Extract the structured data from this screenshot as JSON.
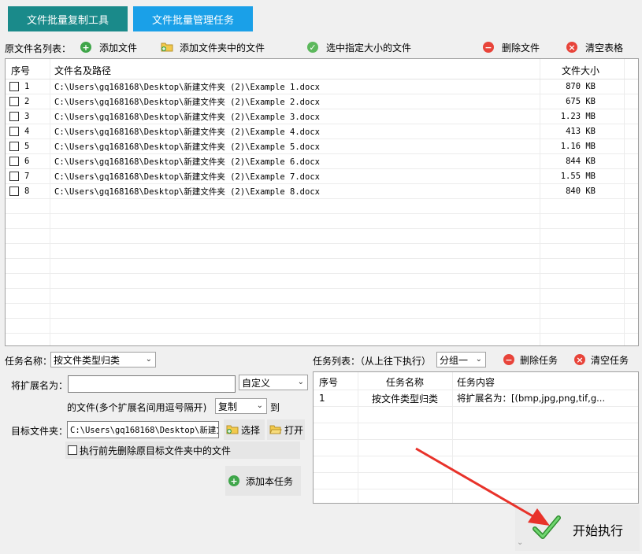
{
  "tabs": [
    {
      "label": "文件批量复制工具"
    },
    {
      "label": "文件批量管理任务"
    }
  ],
  "toolbar": {
    "label": "原文件名列表：",
    "add_file": "添加文件",
    "add_folder": "添加文件夹中的文件",
    "select_size": "选中指定大小的文件",
    "delete_file": "删除文件",
    "clear_table": "清空表格"
  },
  "file_table": {
    "headers": {
      "index": "序号",
      "path": "文件名及路径",
      "size": "文件大小"
    },
    "rows": [
      {
        "index": "1",
        "path": "C:\\Users\\gq168168\\Desktop\\新建文件夹 (2)\\Example 1.docx",
        "size": "870 KB"
      },
      {
        "index": "2",
        "path": "C:\\Users\\gq168168\\Desktop\\新建文件夹 (2)\\Example 2.docx",
        "size": "675 KB"
      },
      {
        "index": "3",
        "path": "C:\\Users\\gq168168\\Desktop\\新建文件夹 (2)\\Example 3.docx",
        "size": "1.23 MB"
      },
      {
        "index": "4",
        "path": "C:\\Users\\gq168168\\Desktop\\新建文件夹 (2)\\Example 4.docx",
        "size": "413 KB"
      },
      {
        "index": "5",
        "path": "C:\\Users\\gq168168\\Desktop\\新建文件夹 (2)\\Example 5.docx",
        "size": "1.16 MB"
      },
      {
        "index": "6",
        "path": "C:\\Users\\gq168168\\Desktop\\新建文件夹 (2)\\Example 6.docx",
        "size": "844 KB"
      },
      {
        "index": "7",
        "path": "C:\\Users\\gq168168\\Desktop\\新建文件夹 (2)\\Example 7.docx",
        "size": "1.55 MB"
      },
      {
        "index": "8",
        "path": "C:\\Users\\gq168168\\Desktop\\新建文件夹 (2)\\Example 8.docx",
        "size": "840 KB"
      }
    ]
  },
  "task_form": {
    "task_name_label": "任务名称：",
    "task_name_value": "按文件类型归类",
    "rename_ext_label": "将扩展名为：",
    "rename_ext_value": "",
    "ext_mode_value": "自定义",
    "files_hint": "的文件(多个扩展名间用逗号隔开)",
    "action_value": "复制",
    "to_label": "到",
    "target_label": "目标文件夹：",
    "target_value": "C:\\Users\\gq168168\\Desktop\\新建文",
    "choose_label": "选择",
    "open_label": "打开",
    "delete_before_label": "执行前先删除原目标文件夹中的文件",
    "add_task_label": "添加本任务"
  },
  "task_list": {
    "label": "任务列表：（从上往下执行）",
    "group_value": "分组一",
    "delete_task": "删除任务",
    "clear_tasks": "清空任务",
    "headers": {
      "index": "序号",
      "name": "任务名称",
      "content": "任务内容"
    },
    "rows": [
      {
        "index": "1",
        "name": "按文件类型归类",
        "content": "将扩展名为：[(bmp,jpg,png,tif,g..."
      }
    ]
  },
  "start_label": "开始执行",
  "colors": {
    "tab1": "#1a8a8a",
    "tab2": "#1aa0e8",
    "add_green": "#3fa64a",
    "delete_red": "#e8443a",
    "check_green": "#5cb85c"
  }
}
